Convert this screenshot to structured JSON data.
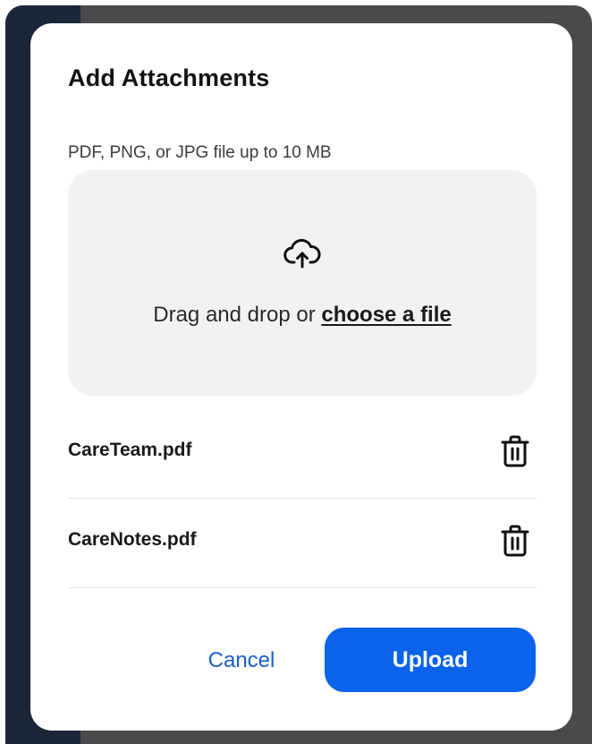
{
  "modal": {
    "title": "Add Attachments",
    "hint": "PDF, PNG, or JPG file up to 10 MB"
  },
  "dropzone": {
    "prefix": "Drag and drop or ",
    "link_label": "choose a file",
    "icon": "cloud-upload-icon"
  },
  "files": [
    {
      "name": "CareTeam.pdf",
      "delete_icon": "trash-icon"
    },
    {
      "name": "CareNotes.pdf",
      "delete_icon": "trash-icon"
    }
  ],
  "actions": {
    "cancel_label": "Cancel",
    "upload_label": "Upload"
  },
  "colors": {
    "primary": "#0a63ea",
    "link": "#1a5fc8",
    "backdrop": "#4a4a4c",
    "sidebar": "#1b2638",
    "dropzone_bg": "#f2f2f2"
  }
}
